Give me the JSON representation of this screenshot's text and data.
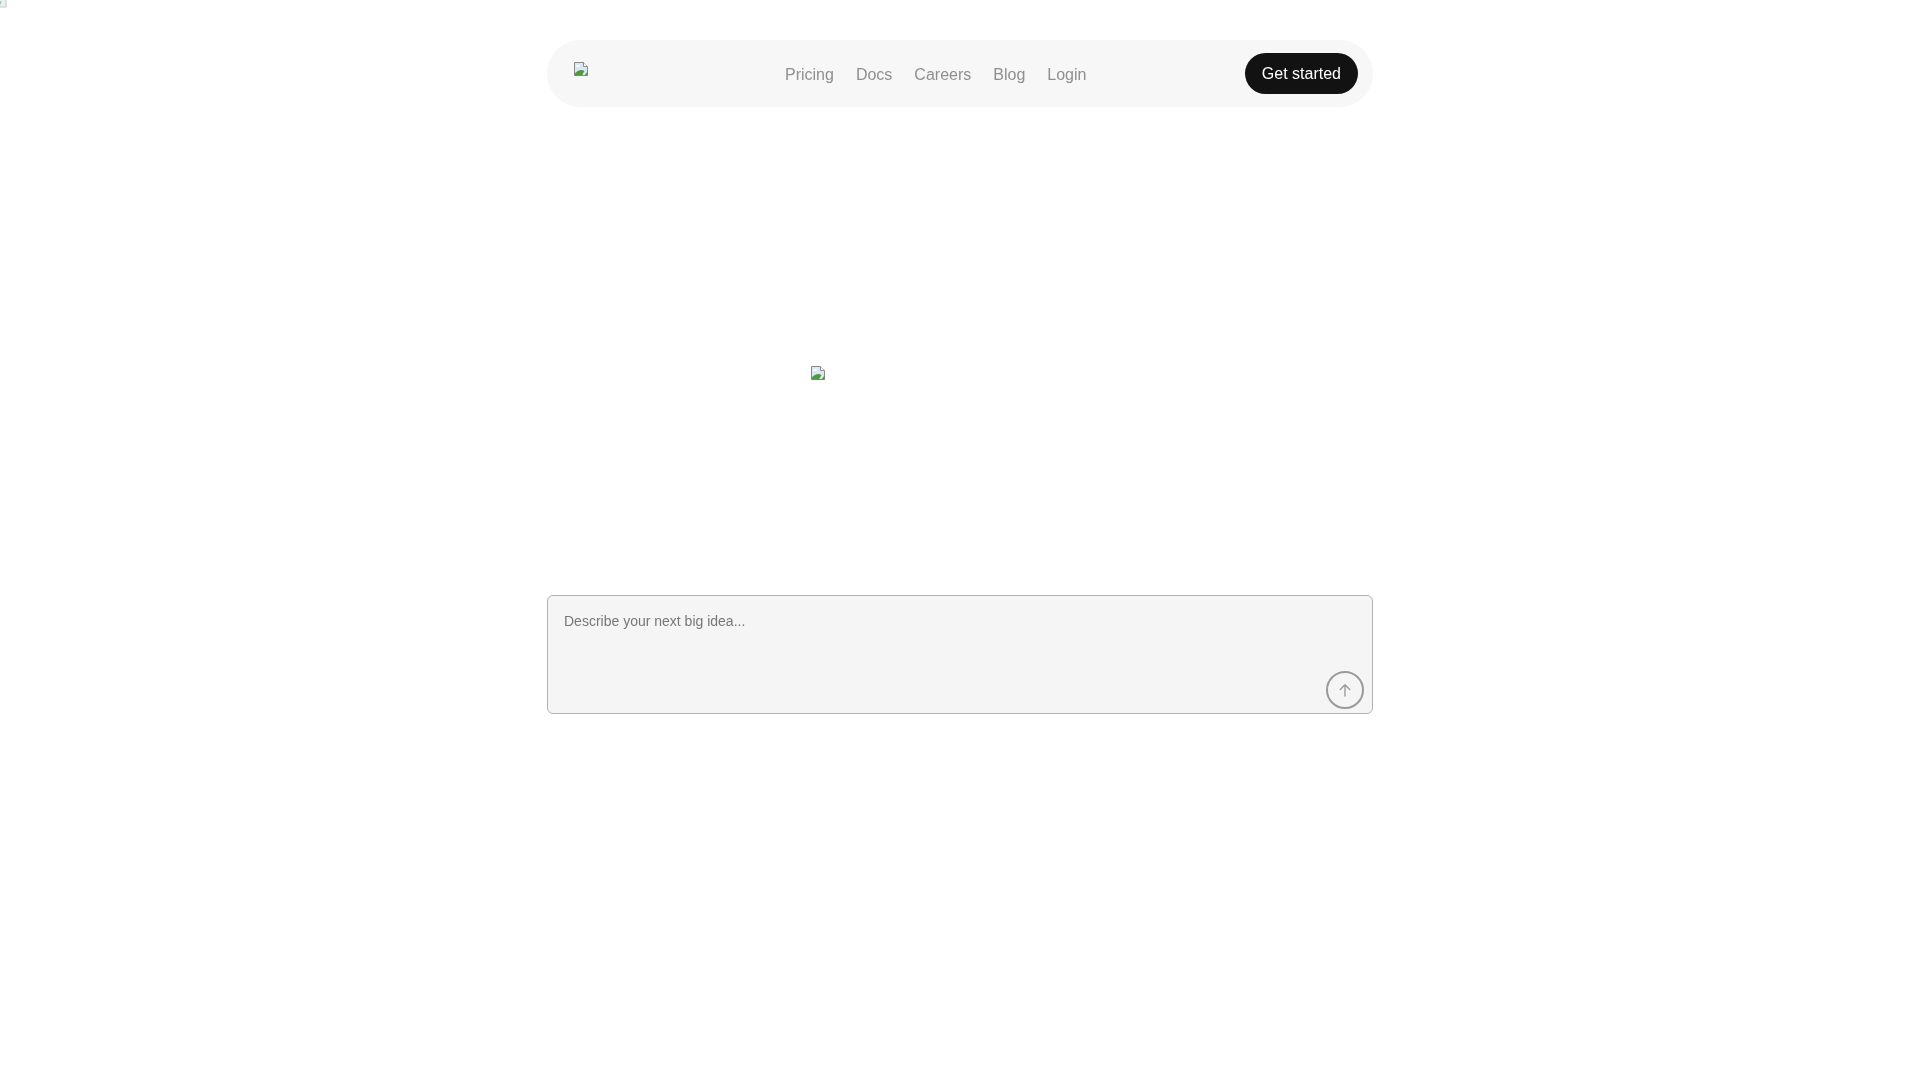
{
  "nav": {
    "links": [
      {
        "label": "Pricing"
      },
      {
        "label": "Docs"
      },
      {
        "label": "Careers"
      },
      {
        "label": "Blog"
      },
      {
        "label": "Login"
      }
    ],
    "cta": "Get started"
  },
  "prompt": {
    "placeholder": "Describe your next big idea..."
  }
}
